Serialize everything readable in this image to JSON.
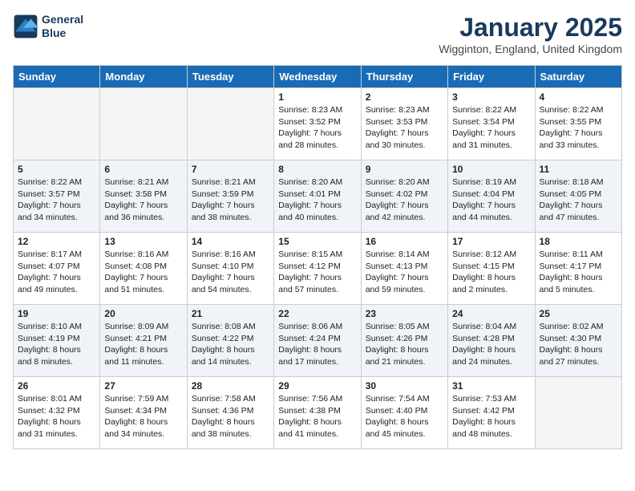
{
  "header": {
    "logo_line1": "General",
    "logo_line2": "Blue",
    "month": "January 2025",
    "location": "Wigginton, England, United Kingdom"
  },
  "days_of_week": [
    "Sunday",
    "Monday",
    "Tuesday",
    "Wednesday",
    "Thursday",
    "Friday",
    "Saturday"
  ],
  "weeks": [
    [
      {
        "day": "",
        "info": ""
      },
      {
        "day": "",
        "info": ""
      },
      {
        "day": "",
        "info": ""
      },
      {
        "day": "1",
        "info": "Sunrise: 8:23 AM\nSunset: 3:52 PM\nDaylight: 7 hours\nand 28 minutes."
      },
      {
        "day": "2",
        "info": "Sunrise: 8:23 AM\nSunset: 3:53 PM\nDaylight: 7 hours\nand 30 minutes."
      },
      {
        "day": "3",
        "info": "Sunrise: 8:22 AM\nSunset: 3:54 PM\nDaylight: 7 hours\nand 31 minutes."
      },
      {
        "day": "4",
        "info": "Sunrise: 8:22 AM\nSunset: 3:55 PM\nDaylight: 7 hours\nand 33 minutes."
      }
    ],
    [
      {
        "day": "5",
        "info": "Sunrise: 8:22 AM\nSunset: 3:57 PM\nDaylight: 7 hours\nand 34 minutes."
      },
      {
        "day": "6",
        "info": "Sunrise: 8:21 AM\nSunset: 3:58 PM\nDaylight: 7 hours\nand 36 minutes."
      },
      {
        "day": "7",
        "info": "Sunrise: 8:21 AM\nSunset: 3:59 PM\nDaylight: 7 hours\nand 38 minutes."
      },
      {
        "day": "8",
        "info": "Sunrise: 8:20 AM\nSunset: 4:01 PM\nDaylight: 7 hours\nand 40 minutes."
      },
      {
        "day": "9",
        "info": "Sunrise: 8:20 AM\nSunset: 4:02 PM\nDaylight: 7 hours\nand 42 minutes."
      },
      {
        "day": "10",
        "info": "Sunrise: 8:19 AM\nSunset: 4:04 PM\nDaylight: 7 hours\nand 44 minutes."
      },
      {
        "day": "11",
        "info": "Sunrise: 8:18 AM\nSunset: 4:05 PM\nDaylight: 7 hours\nand 47 minutes."
      }
    ],
    [
      {
        "day": "12",
        "info": "Sunrise: 8:17 AM\nSunset: 4:07 PM\nDaylight: 7 hours\nand 49 minutes."
      },
      {
        "day": "13",
        "info": "Sunrise: 8:16 AM\nSunset: 4:08 PM\nDaylight: 7 hours\nand 51 minutes."
      },
      {
        "day": "14",
        "info": "Sunrise: 8:16 AM\nSunset: 4:10 PM\nDaylight: 7 hours\nand 54 minutes."
      },
      {
        "day": "15",
        "info": "Sunrise: 8:15 AM\nSunset: 4:12 PM\nDaylight: 7 hours\nand 57 minutes."
      },
      {
        "day": "16",
        "info": "Sunrise: 8:14 AM\nSunset: 4:13 PM\nDaylight: 7 hours\nand 59 minutes."
      },
      {
        "day": "17",
        "info": "Sunrise: 8:12 AM\nSunset: 4:15 PM\nDaylight: 8 hours\nand 2 minutes."
      },
      {
        "day": "18",
        "info": "Sunrise: 8:11 AM\nSunset: 4:17 PM\nDaylight: 8 hours\nand 5 minutes."
      }
    ],
    [
      {
        "day": "19",
        "info": "Sunrise: 8:10 AM\nSunset: 4:19 PM\nDaylight: 8 hours\nand 8 minutes."
      },
      {
        "day": "20",
        "info": "Sunrise: 8:09 AM\nSunset: 4:21 PM\nDaylight: 8 hours\nand 11 minutes."
      },
      {
        "day": "21",
        "info": "Sunrise: 8:08 AM\nSunset: 4:22 PM\nDaylight: 8 hours\nand 14 minutes."
      },
      {
        "day": "22",
        "info": "Sunrise: 8:06 AM\nSunset: 4:24 PM\nDaylight: 8 hours\nand 17 minutes."
      },
      {
        "day": "23",
        "info": "Sunrise: 8:05 AM\nSunset: 4:26 PM\nDaylight: 8 hours\nand 21 minutes."
      },
      {
        "day": "24",
        "info": "Sunrise: 8:04 AM\nSunset: 4:28 PM\nDaylight: 8 hours\nand 24 minutes."
      },
      {
        "day": "25",
        "info": "Sunrise: 8:02 AM\nSunset: 4:30 PM\nDaylight: 8 hours\nand 27 minutes."
      }
    ],
    [
      {
        "day": "26",
        "info": "Sunrise: 8:01 AM\nSunset: 4:32 PM\nDaylight: 8 hours\nand 31 minutes."
      },
      {
        "day": "27",
        "info": "Sunrise: 7:59 AM\nSunset: 4:34 PM\nDaylight: 8 hours\nand 34 minutes."
      },
      {
        "day": "28",
        "info": "Sunrise: 7:58 AM\nSunset: 4:36 PM\nDaylight: 8 hours\nand 38 minutes."
      },
      {
        "day": "29",
        "info": "Sunrise: 7:56 AM\nSunset: 4:38 PM\nDaylight: 8 hours\nand 41 minutes."
      },
      {
        "day": "30",
        "info": "Sunrise: 7:54 AM\nSunset: 4:40 PM\nDaylight: 8 hours\nand 45 minutes."
      },
      {
        "day": "31",
        "info": "Sunrise: 7:53 AM\nSunset: 4:42 PM\nDaylight: 8 hours\nand 48 minutes."
      },
      {
        "day": "",
        "info": ""
      }
    ]
  ]
}
